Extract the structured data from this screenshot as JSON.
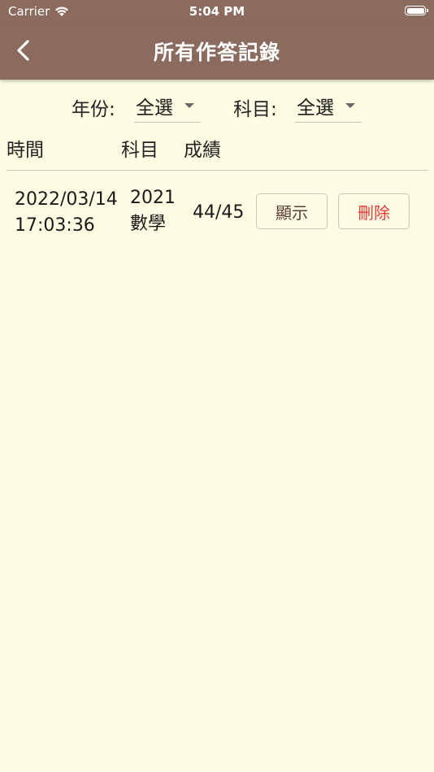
{
  "status_bar": {
    "carrier": "Carrier",
    "time": "5:04 PM"
  },
  "nav": {
    "title": "所有作答記錄"
  },
  "filters": {
    "year_label": "年份:",
    "year_value": "全選",
    "subject_label": "科目:",
    "subject_value": "全選"
  },
  "table": {
    "headers": {
      "time": "時間",
      "subject": "科目",
      "score": "成績"
    },
    "rows": [
      {
        "time_line1": "2022/03/14",
        "time_line2": "17:03:36",
        "subject_line1": "2021",
        "subject_line2": "數學",
        "score": "44/45",
        "show_label": "顯示",
        "delete_label": "刪除"
      }
    ]
  },
  "colors": {
    "header_bg": "#8c6b5f",
    "page_bg": "#fefde3",
    "delete_text": "#e53935",
    "show_text": "#5a3e2b"
  }
}
